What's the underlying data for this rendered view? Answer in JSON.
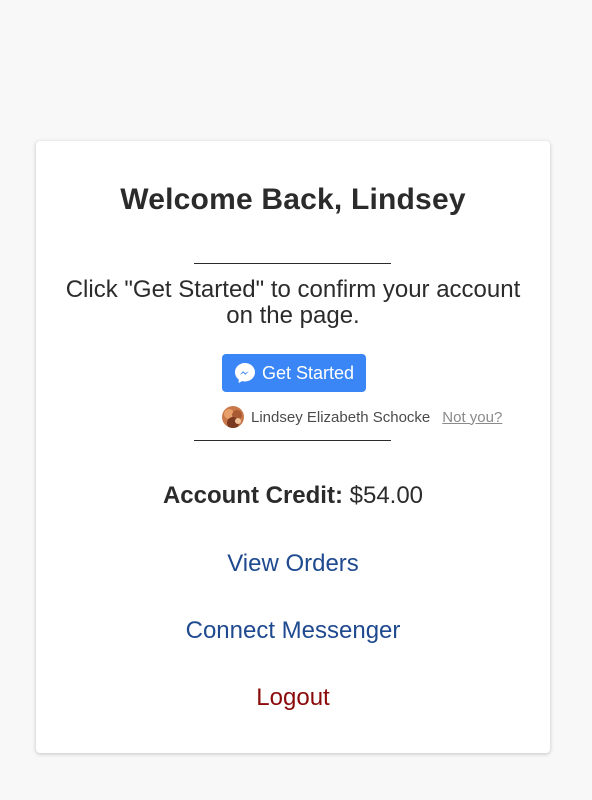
{
  "card": {
    "title": "Welcome Back, Lindsey",
    "instructions": "Click \"Get Started\" to confirm your account on the page.",
    "get_started_label": "Get Started",
    "user_name": "Lindsey Elizabeth Schocke",
    "not_you_label": "Not you?",
    "credit_label": "Account Credit:",
    "credit_value": "$54.00",
    "view_orders_label": "View Orders",
    "connect_messenger_label": "Connect Messenger",
    "logout_label": "Logout"
  },
  "icons": {
    "button_icon": "messenger-icon",
    "avatar": "user-avatar"
  },
  "colors": {
    "button_bg": "#3b86f7",
    "link": "#1f4a8f",
    "logout": "#8b0a0a",
    "text": "#2b2b2b"
  }
}
